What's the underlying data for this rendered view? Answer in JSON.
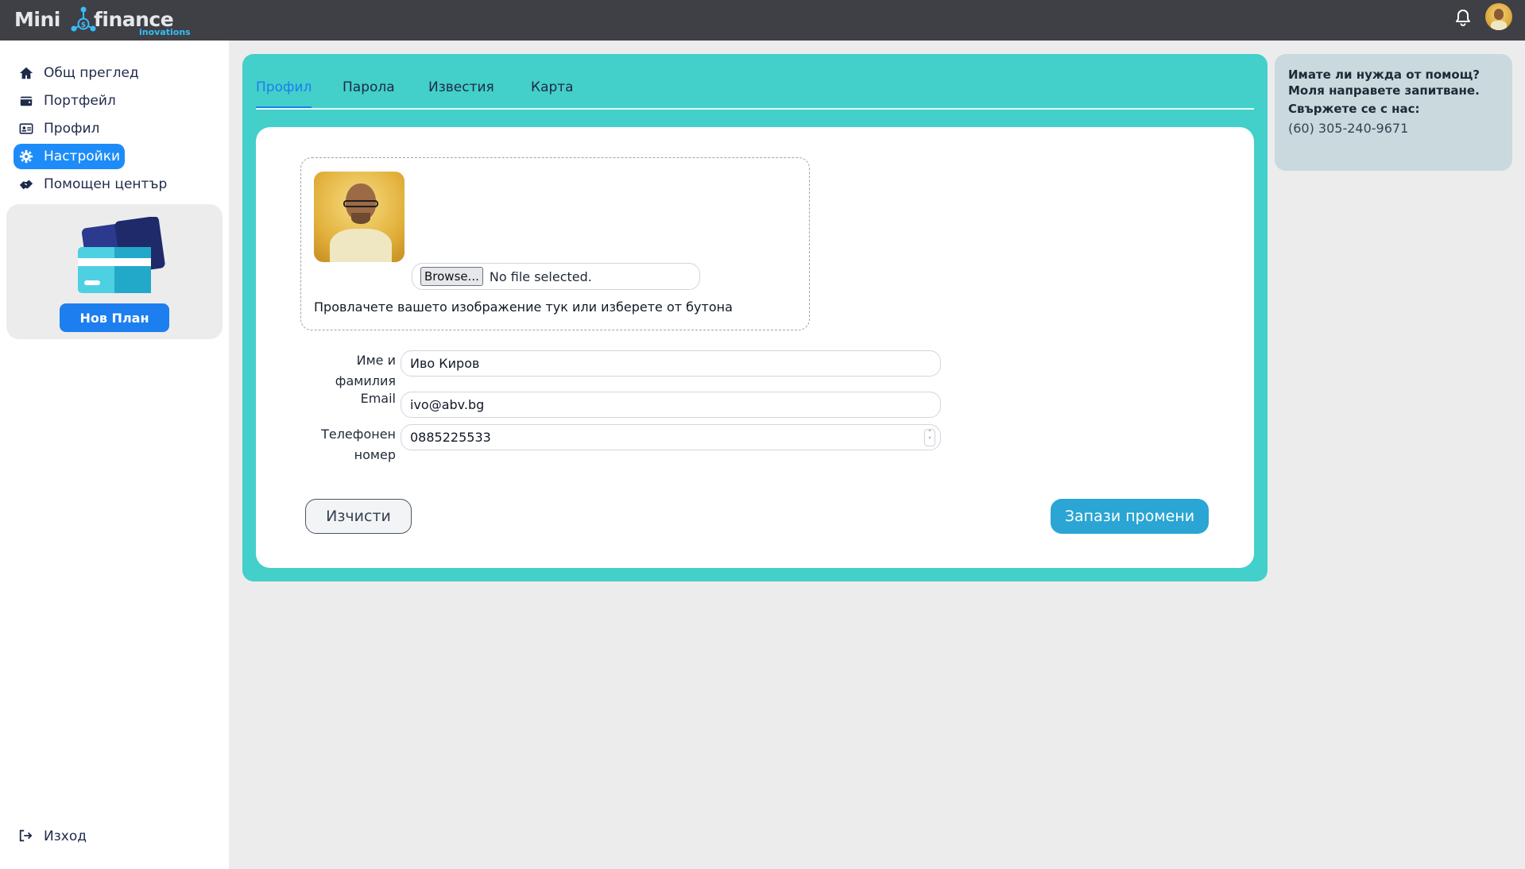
{
  "header": {
    "logo_word1": "Mini",
    "logo_word2": "finance",
    "logo_sub": "inovations",
    "icons": [
      "bell-icon",
      "user-avatar"
    ]
  },
  "sidebar": {
    "items": [
      {
        "label": "Общ преглед",
        "icon": "home-icon"
      },
      {
        "label": "Портфейл",
        "icon": "wallet-icon"
      },
      {
        "label": "Профил",
        "icon": "id-card-icon"
      },
      {
        "label": "Настройки",
        "icon": "gear-icon",
        "active": true
      },
      {
        "label": "Помощен център",
        "icon": "handshake-icon"
      }
    ],
    "promo_button": "Нов План",
    "logout": "Изход"
  },
  "tabs": [
    {
      "label": "Профил",
      "active": true
    },
    {
      "label": "Парола"
    },
    {
      "label": "Известия"
    },
    {
      "label": "Карта"
    }
  ],
  "upload": {
    "browse_label": "Browse...",
    "file_status": "No file selected.",
    "hint": "Провлачете вашето изображение тук или изберете от бутона"
  },
  "form": {
    "name_label_line1": "Име и",
    "name_label_line2": "фамилия",
    "name_value": "Иво Киров",
    "email_label": "Email",
    "email_value": "ivo@abv.bg",
    "phone_label_line1": "Телефонен",
    "phone_label_line2": "номер",
    "phone_value": "0885225533"
  },
  "actions": {
    "clear": "Изчисти",
    "save": "Запази промени"
  },
  "help": {
    "question": "Имате ли нужда от помощ? Моля направете запитване.",
    "contact_label": "Свържете се с нас:",
    "phone": "(60) 305-240-9671"
  },
  "colors": {
    "topbar": "#3f3f46",
    "accent": "#1d8cf8",
    "panel": "#43cfca",
    "save_button": "#2aa5d4",
    "help_box": "#c9d9dd"
  }
}
